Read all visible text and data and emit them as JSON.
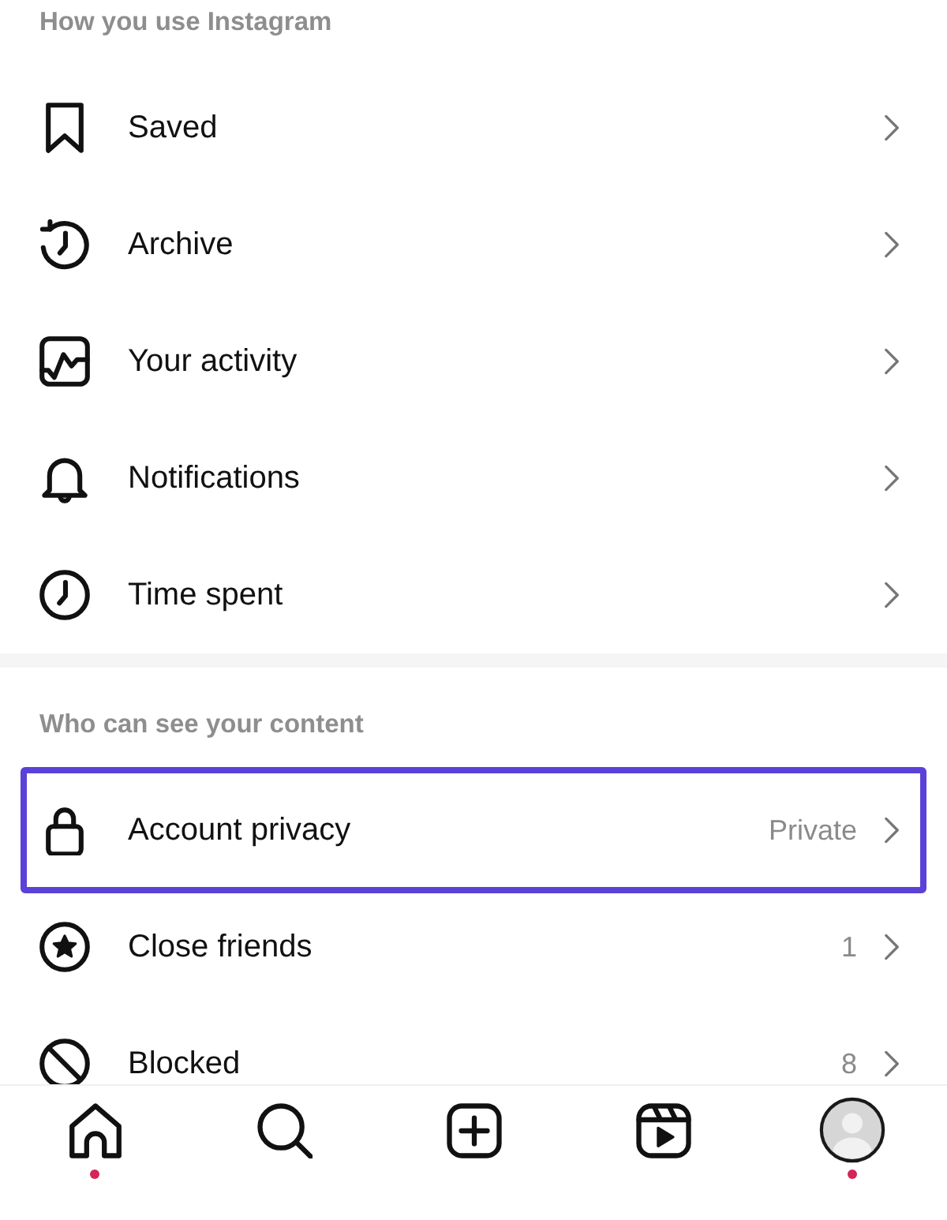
{
  "sections": [
    {
      "header": "How you use Instagram",
      "items": [
        {
          "label": "Saved",
          "selected": false
        },
        {
          "label": "Archive",
          "selected": false
        },
        {
          "label": "Your activity",
          "selected": false
        },
        {
          "label": "Notifications",
          "selected": false
        },
        {
          "label": "Time spent",
          "selected": false
        }
      ]
    },
    {
      "header": "Who can see your content",
      "items": [
        {
          "label": "Account privacy",
          "value": "Private",
          "selected": true
        },
        {
          "label": "Close friends",
          "value": "1",
          "selected": false
        },
        {
          "label": "Blocked",
          "value": "8",
          "selected": false
        }
      ]
    }
  ],
  "tab_bar": {
    "items": [
      {
        "notification_dot": true
      },
      {
        "notification_dot": false
      },
      {
        "notification_dot": false
      },
      {
        "notification_dot": false
      },
      {
        "notification_dot": true
      }
    ]
  }
}
